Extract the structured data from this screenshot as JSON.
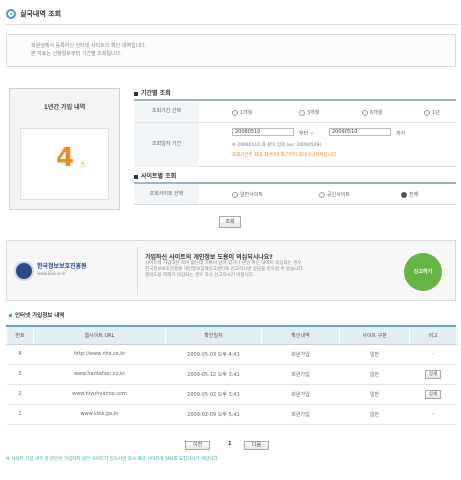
{
  "header": {
    "title": "실국내역 조회"
  },
  "notice": {
    "lines": [
      "회원님께서 등록하신 인터넷 사이트의 확인 내역입니다.",
      "본 자료는 신청일로부터 기간별 조회됩니다."
    ]
  },
  "summary": {
    "title": "1년간 가입 내역",
    "count": "4",
    "unit": "건"
  },
  "section_period": {
    "title": "기간별 조회",
    "row1_label": "조회기간 선택",
    "options": [
      "1개월",
      "3개월",
      "6개월",
      "1년"
    ],
    "row2_label": "조회일자 기간",
    "date_from": "20080510",
    "date_sep": "부터 ~",
    "date_to": "20090510",
    "date_suffix": "까지",
    "example": "※ 20090510 과 같이 입력 (ex: 20090509)",
    "warning": "조회기간은 최대 1년이며 최근부터 최대 1년까지입니다."
  },
  "section_site": {
    "title": "사이트별 조회",
    "row_label": "조회사이트 선택",
    "options": [
      "일반사이트",
      "공인사이트",
      "전체"
    ],
    "selected_index": 2
  },
  "search_button": "조회",
  "banner": {
    "logo_name": "한국정보보호진흥원",
    "logo_sub": "www.kisa.or.kr",
    "headline": "가입하신 사이트의 개인정보 도용이 의심되시나요?",
    "body_lines": [
      "사이트에 가입하신 적이 없는데 기록이 남아 있거나 본인 확인 내역이 의심되는 경우",
      "한국정보보호진흥원 개인정보침해신고센터로 신고하시면 상담을 받으실 수 있습니다.",
      "명의도용 피해가 의심되는 경우 즉시 신고하시기 바랍니다."
    ],
    "go_label": "신고하기"
  },
  "list": {
    "title": "인터넷 가입정보 내역",
    "columns": [
      "번호",
      "웹사이트 URL",
      "확인일자",
      "확인내역",
      "사이트 구분",
      "비고"
    ],
    "rows": [
      {
        "no": "4",
        "url": "http://www.nhs.co.kr",
        "date": "2009-05-03 오후 4:41",
        "status": "회원가입",
        "type": "일반",
        "action": "-"
      },
      {
        "no": "3",
        "url": "www.hardahan.co.kr",
        "date": "2009-05-12 오후 3:41",
        "status": "회원가입",
        "type": "일반",
        "action": "상세"
      },
      {
        "no": "2",
        "url": "www.hiyuhyahoo.com",
        "date": "2009-05-02 오후 3:41",
        "status": "회원가입",
        "type": "일반",
        "action": "상세"
      },
      {
        "no": "1",
        "url": "www.klex.go.kr",
        "date": "2009-02-09 오후 5:41",
        "status": "회원가입",
        "type": "일반",
        "action": "-"
      }
    ]
  },
  "pager": {
    "prev": "이전",
    "current": "1",
    "next": "다음"
  },
  "footer_note": "※ 사이트 가입 내역 중 본인이 가입하지 않은 사이트가 있으시면 즉시 해당 사이트에 탈퇴를 요청하시기 바랍니다.",
  "colors": {
    "accent": "#3aa7b8",
    "count_orange": "#ef8a1d",
    "warning_orange": "#e0801e",
    "banner_green": "#64b543",
    "logo_blue": "#2c4b8a"
  }
}
